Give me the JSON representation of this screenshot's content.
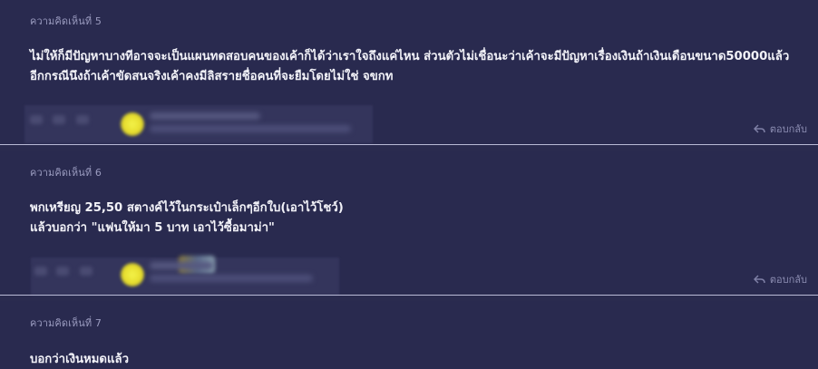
{
  "comments": [
    {
      "number_label": "ความคิดเห็นที่ 5",
      "body_lines": [
        "ไม่ให้ก็มีปัญหาบางทีอาจจะเป็นแผนทดสอบคนของเค้าก็ได้ว่าเราใจถึงแค่ไหน ส่วนตัวไม่เชื่อนะว่าเค้าจะมีปัญหาเรื่องเงินถ้าเงินเดือนขนาด50000แล้ว",
        "อีกกรณีนึงถ้าเค้าขัดสนจริงเค้าคงมีลิสรายชื่อคนที่จะยืมโดยไม่ใช่ จขกท"
      ],
      "reply_label": "ตอบกลับ"
    },
    {
      "number_label": "ความคิดเห็นที่ 6",
      "body_lines": [
        "พกเหรียญ 25,50 สตางค์ไว้ในกระเป๋าเล็กๆอีกใบ(เอาไว้โชว์)",
        "แล้วบอกว่า \"แฟนให้มา 5 บาท เอาไว้ซื้อมาม่า\""
      ],
      "reply_label": "ตอบกลับ"
    },
    {
      "number_label": "ความคิดเห็นที่ 7",
      "body_lines": [
        "บอกว่าเงินหมดแล้ว"
      ]
    }
  ],
  "icons": {
    "reply": "reply-arrow-icon",
    "avatar": "user-avatar-icon"
  },
  "colors": {
    "background": "#292a4f",
    "separator": "#b9bad6",
    "body_text": "#f2f2f8",
    "meta_text": "#9a9bbf"
  }
}
